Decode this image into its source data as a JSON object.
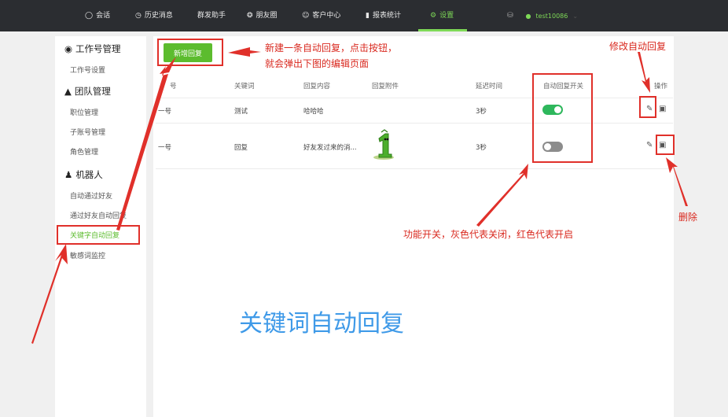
{
  "topbar": {
    "items": [
      {
        "label": "会话",
        "icon": "chat-icon"
      },
      {
        "label": "历史消息",
        "icon": "clock-icon"
      },
      {
        "label": "群发助手",
        "icon": ""
      },
      {
        "label": "朋友圈",
        "icon": "aperture-icon"
      },
      {
        "label": "客户中心",
        "icon": "user-icon"
      },
      {
        "label": "报表统计",
        "icon": "bar-chart-icon"
      },
      {
        "label": "设置",
        "icon": "gear-icon"
      }
    ],
    "active": "设置",
    "username": "test10086",
    "accent": "#7ed957"
  },
  "sidebar": {
    "groups": [
      {
        "title": "工作号管理",
        "icon": "chat-bubbles-icon",
        "items": [
          "工作号设置"
        ]
      },
      {
        "title": "团队管理",
        "icon": "team-icon",
        "items": [
          "职位管理",
          "子账号管理",
          "角色管理"
        ]
      },
      {
        "title": "机器人",
        "icon": "robot-icon",
        "items": [
          "自动通过好友",
          "通过好友自动回复",
          "关键字自动回复",
          "敏感词监控"
        ]
      }
    ],
    "active_item": "关键字自动回复"
  },
  "main": {
    "new_button": "新增回复",
    "columns": [
      "号",
      "关键词",
      "回复内容",
      "回复附件",
      "延迟时间",
      "自动回复开关",
      "操作"
    ],
    "rows": [
      {
        "account": "一号",
        "keyword": "测试",
        "content": "哈哈哈",
        "attachment": "",
        "delay": "3秒",
        "enabled": true
      },
      {
        "account": "一号",
        "keyword": "回复",
        "content": "好友发过来的消...",
        "attachment": "image",
        "delay": "3秒",
        "enabled": false
      }
    ]
  },
  "annotations": {
    "new_line1": "新建一条自动回复，点击按钮，",
    "new_line2": "就会弹出下图的编辑页面",
    "edit": "修改自动回复",
    "delete": "删除",
    "toggle": "功能开关，灰色代表关闭，红色代表开启",
    "title": "关键词自动回复"
  },
  "colors": {
    "toggle_on": "#2eb75c",
    "toggle_off": "#8c8c8c",
    "annotation_red": "#d9291f",
    "title_blue": "#3f9ae8"
  }
}
